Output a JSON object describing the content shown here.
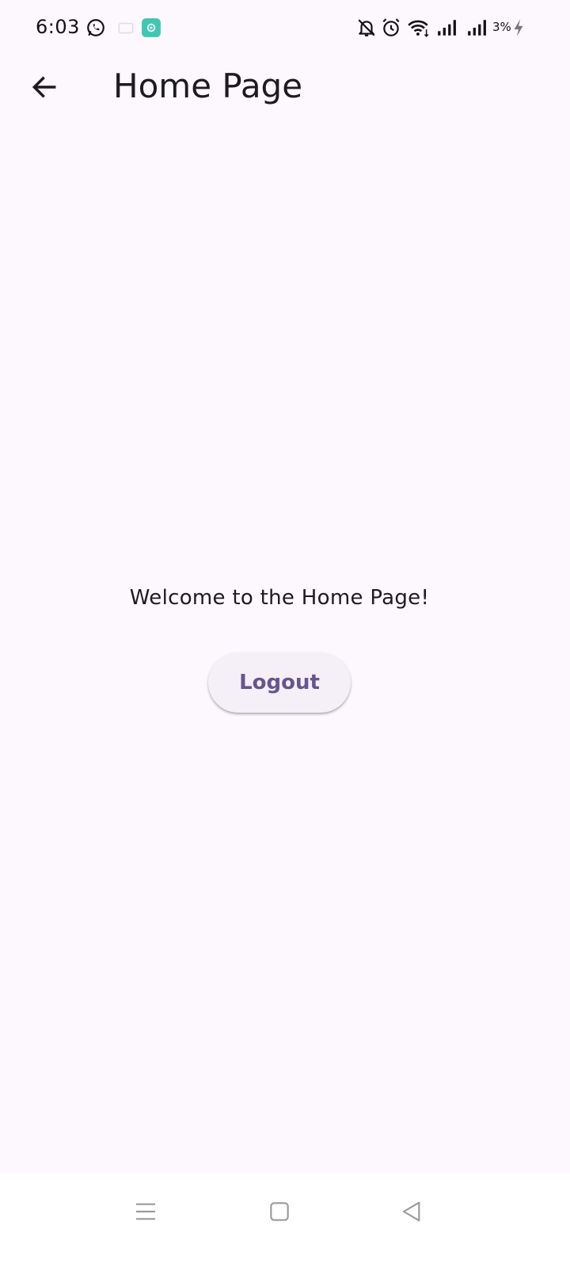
{
  "status_bar": {
    "time": "6:03",
    "battery": "3%",
    "icons": [
      "whatsapp-icon",
      "notification-icon",
      "app-icon",
      "bell-off-icon",
      "alarm-icon",
      "wifi-icon",
      "signal-icon",
      "signal-icon",
      "charging-icon"
    ]
  },
  "app_bar": {
    "title": "Home Page",
    "back_icon": "arrow-left-icon"
  },
  "main": {
    "welcome": "Welcome to the Home Page!",
    "logout_label": "Logout"
  },
  "nav_bar": {
    "icons": [
      "menu-icon",
      "home-square-icon",
      "back-triangle-icon"
    ]
  },
  "colors": {
    "background": "#fdf7fe",
    "button_bg": "#f5eff7",
    "button_text": "#65558f",
    "app_icon": "#3fc7b4"
  }
}
